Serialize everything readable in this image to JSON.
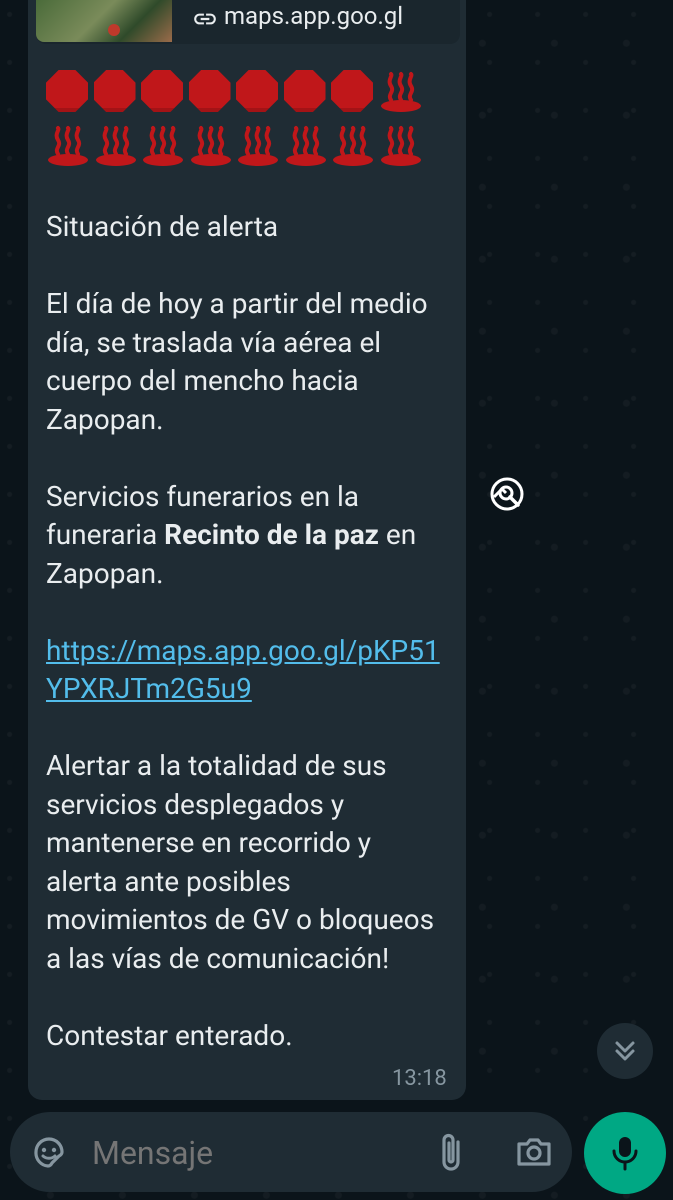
{
  "link_preview": {
    "url": "maps.app.goo.gl"
  },
  "emoji_rows": [
    [
      "stop-sign",
      "stop-sign",
      "stop-sign",
      "stop-sign",
      "stop-sign",
      "stop-sign",
      "stop-sign",
      "hot-springs"
    ],
    [
      "hot-springs",
      "hot-springs",
      "hot-springs",
      "hot-springs",
      "hot-springs",
      "hot-springs",
      "hot-springs",
      "hot-springs"
    ]
  ],
  "message": {
    "p1": "Situación de alerta",
    "p2": "El día de hoy a partir del medio día, se traslada vía aérea el cuerpo del mencho hacia Zapopan.",
    "p3_before": "Servicios funerarios en la funeraria ",
    "p3_bold": "Recinto de la paz",
    "p3_after": " en Zapopan.",
    "link_text": "https://maps.app.goo.gl/pKP51YPXRJTm2G5u9",
    "p5": "Alertar a la totalidad de sus servicios desplegados y mantenerse en recorrido y alerta ante posibles movimientos de GV o bloqueos a las vías de comunicación!",
    "p6": "Contestar enterado.",
    "time": "13:18"
  },
  "input": {
    "placeholder": "Mensaje"
  },
  "colors": {
    "background": "#0b141a",
    "bubble": "#1f2c34",
    "text": "#e9edef",
    "link": "#53bdeb",
    "meta": "#8696a0",
    "mic": "#00a884",
    "stop_red": "#c0171a"
  }
}
